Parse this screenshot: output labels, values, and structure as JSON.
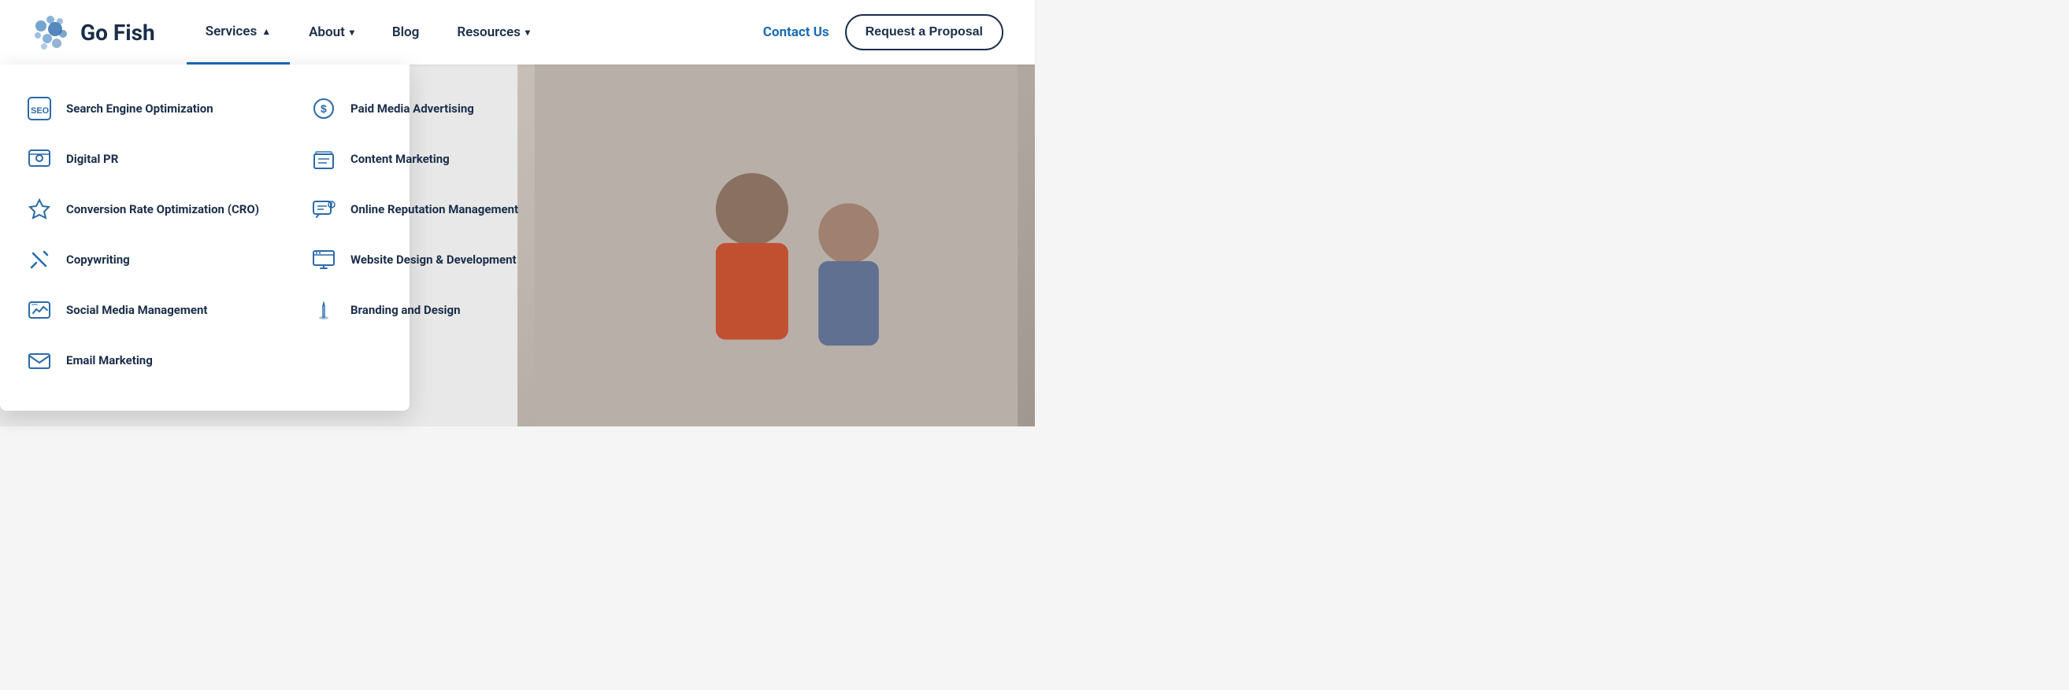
{
  "brand": {
    "name": "Go Fish",
    "logo_alt": "Go Fish logo"
  },
  "nav": {
    "items": [
      {
        "label": "Services",
        "has_dropdown": true,
        "active": true,
        "chevron": "▲"
      },
      {
        "label": "About",
        "has_dropdown": true,
        "active": false,
        "chevron": "▾"
      },
      {
        "label": "Blog",
        "has_dropdown": false,
        "active": false
      },
      {
        "label": "Resources",
        "has_dropdown": true,
        "active": false,
        "chevron": "▾"
      }
    ],
    "contact_label": "Contact Us",
    "proposal_label": "Request a Proposal"
  },
  "services_dropdown": {
    "left": [
      {
        "label": "Search Engine Optimization",
        "icon": "seo"
      },
      {
        "label": "Digital PR",
        "icon": "pr"
      },
      {
        "label": "Conversion Rate Optimization (CRO)",
        "icon": "cro"
      },
      {
        "label": "Copywriting",
        "icon": "copy"
      },
      {
        "label": "Social Media Management",
        "icon": "social"
      },
      {
        "label": "Email Marketing",
        "icon": "email"
      }
    ],
    "right": [
      {
        "label": "Paid Media Advertising",
        "icon": "paid"
      },
      {
        "label": "Content Marketing",
        "icon": "content"
      },
      {
        "label": "Online Reputation Management",
        "icon": "orm"
      },
      {
        "label": "Website Design & Development",
        "icon": "web"
      },
      {
        "label": "Branding and Design",
        "icon": "brand"
      }
    ]
  }
}
